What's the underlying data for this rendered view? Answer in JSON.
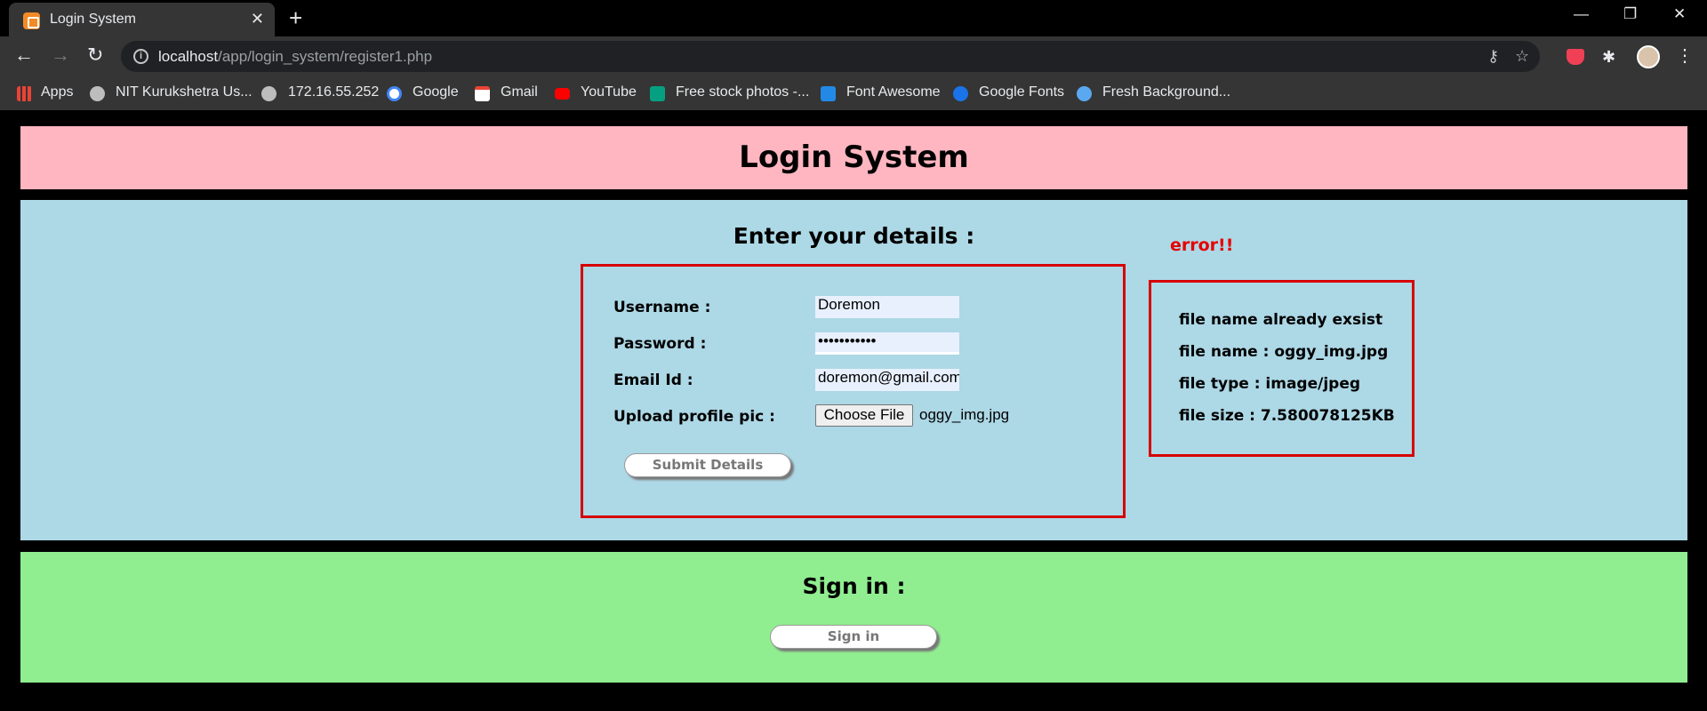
{
  "browser": {
    "tab_title": "Login System",
    "url_host": "localhost",
    "url_path": "/app/login_system/register1.php",
    "bookmarks": [
      {
        "label": "Apps",
        "icon": "apps-grid-icon"
      },
      {
        "label": "NIT Kurukshetra Us...",
        "icon": "globe-icon"
      },
      {
        "label": "172.16.55.252",
        "icon": "globe-icon"
      },
      {
        "label": "Google",
        "icon": "google-icon"
      },
      {
        "label": "Gmail",
        "icon": "gmail-icon"
      },
      {
        "label": "YouTube",
        "icon": "youtube-icon"
      },
      {
        "label": "Free stock photos -...",
        "icon": "stock-photos-icon"
      },
      {
        "label": "Font Awesome",
        "icon": "flag-icon"
      },
      {
        "label": "Google Fonts",
        "icon": "google-fonts-icon"
      },
      {
        "label": "Fresh Background...",
        "icon": "background-icon"
      }
    ]
  },
  "page": {
    "header_title": "Login System",
    "details_title": "Enter your details :",
    "error_title": "error!!",
    "form": {
      "username_label": "Username :",
      "username_value": "Doremon",
      "password_label": "Password :",
      "password_value": "•••••••••••",
      "email_label": "Email Id :",
      "email_value": "doremon@gmail.com",
      "upload_label": "Upload profile pic :",
      "choose_file_label": "Choose File",
      "file_name": "oggy_img.jpg",
      "submit_label": "Submit Details"
    },
    "errors": [
      "file name already exsist",
      "file name : oggy_img.jpg",
      "file type : image/jpeg",
      "file size : 7.580078125KB"
    ],
    "signin_title": "Sign in :",
    "signin_button": "Sign in"
  },
  "colors": {
    "header_bg": "#ffb6c1",
    "main_bg": "#add8e6",
    "signin_bg": "#90ee90",
    "box_border": "#d60000",
    "error_text": "#e60000"
  }
}
